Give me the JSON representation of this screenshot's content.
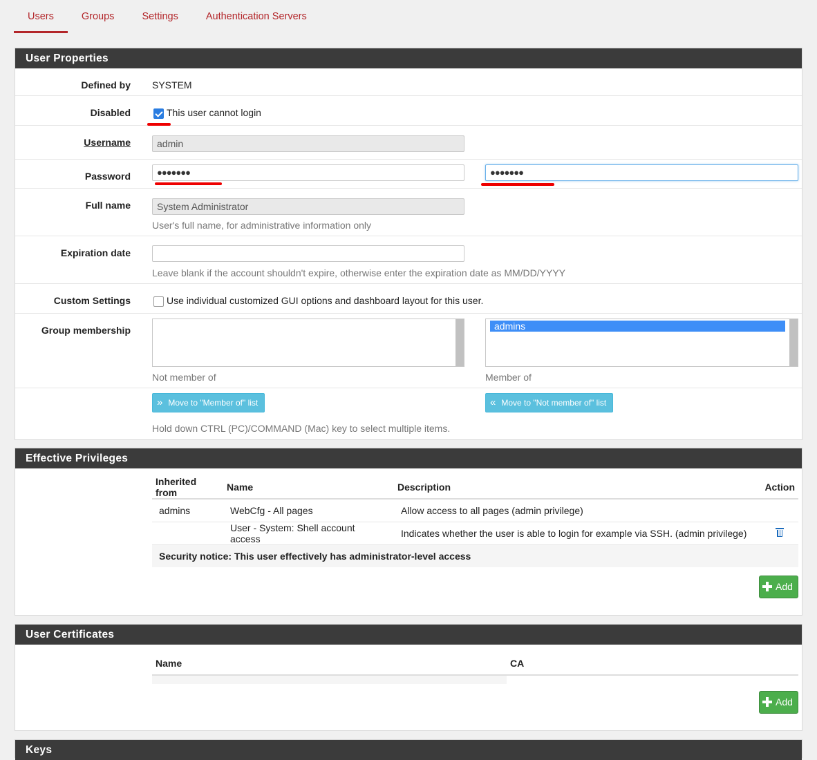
{
  "tabs": [
    {
      "label": "Users",
      "active": true
    },
    {
      "label": "Groups",
      "active": false
    },
    {
      "label": "Settings",
      "active": false
    },
    {
      "label": "Authentication Servers",
      "active": false
    }
  ],
  "user_properties": {
    "heading": "User Properties",
    "defined_by_label": "Defined by",
    "defined_by_value": "SYSTEM",
    "disabled_label": "Disabled",
    "disabled_checked": true,
    "disabled_text": "This user cannot login",
    "username_label": "Username",
    "username_value": "admin",
    "password_label": "Password",
    "password_value": "●●●●●●●",
    "password_confirm_value": "●●●●●●●",
    "fullname_label": "Full name",
    "fullname_value": "System Administrator",
    "fullname_help": "User's full name, for administrative information only",
    "expiration_label": "Expiration date",
    "expiration_value": "",
    "expiration_help": "Leave blank if the account shouldn't expire, otherwise enter the expiration date as MM/DD/YYYY",
    "custom_label": "Custom Settings",
    "custom_checked": false,
    "custom_text": "Use individual customized GUI options and dashboard layout for this user.",
    "group_label": "Group membership",
    "not_member_options": [],
    "member_options": [
      "admins"
    ],
    "not_member_caption": "Not member of",
    "member_caption": "Member of",
    "move_to_member_label": "Move to \"Member of\" list",
    "move_to_not_member_label": "Move to \"Not member of\" list",
    "multi_select_help": "Hold down CTRL (PC)/COMMAND (Mac) key to select multiple items."
  },
  "effective_privileges": {
    "heading": "Effective Privileges",
    "columns": [
      "Inherited from",
      "Name",
      "Description",
      "Action"
    ],
    "rows": [
      {
        "inherited": "admins",
        "name": "WebCfg - All pages",
        "description": "Allow access to all pages (admin privilege)",
        "deletable": false
      },
      {
        "inherited": "",
        "name": "User - System: Shell account access",
        "description": "Indicates whether the user is able to login for example via SSH. (admin privilege)",
        "deletable": true
      }
    ],
    "notice": "Security notice: This user effectively has administrator-level access",
    "add_label": "Add"
  },
  "user_certificates": {
    "heading": "User Certificates",
    "columns": [
      "Name",
      "CA"
    ],
    "add_label": "Add"
  },
  "keys": {
    "heading": "Keys"
  },
  "colors": {
    "accent": "#b3262a",
    "header_bg": "#3b3b3b",
    "info_button": "#5bc0de",
    "success_button": "#4cae4c",
    "selected_option": "#3e8ef7",
    "annotation": "#e00000"
  }
}
